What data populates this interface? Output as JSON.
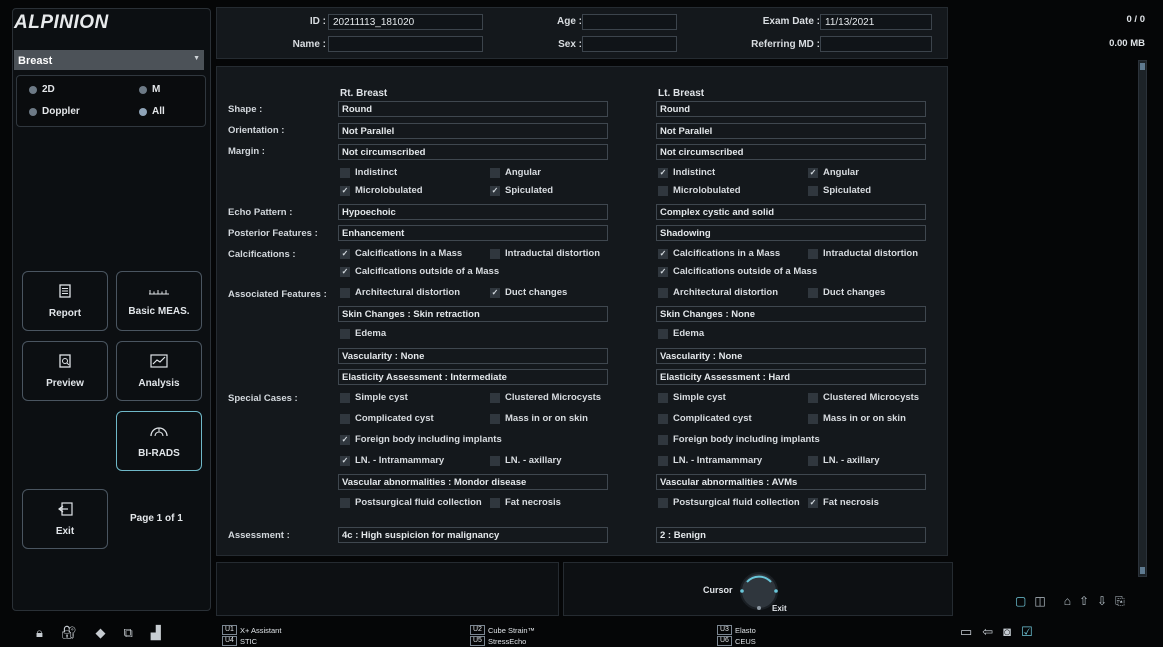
{
  "brand": "ALPINION",
  "preset": "Breast",
  "modes": [
    {
      "label": "2D",
      "selected": false
    },
    {
      "label": "M",
      "selected": false
    },
    {
      "label": "Doppler",
      "selected": false
    },
    {
      "label": "All",
      "selected": true
    }
  ],
  "buttons": {
    "report": "Report",
    "basic_meas": "Basic MEAS.",
    "preview": "Preview",
    "analysis": "Analysis",
    "birads": "BI-RADS",
    "exit": "Exit"
  },
  "page_indicator": "Page 1 of 1",
  "header": {
    "id_label": "ID :",
    "id_value": "20211113_181020",
    "name_label": "Name :",
    "name_value": "",
    "age_label": "Age :",
    "age_value": "",
    "sex_label": "Sex :",
    "sex_value": "",
    "exam_date_label": "Exam Date :",
    "exam_date_value": "11/13/2021",
    "referring_label": "Referring MD :",
    "referring_value": ""
  },
  "columns": {
    "right": "Rt. Breast",
    "left": "Lt. Breast"
  },
  "labels": {
    "shape": "Shape :",
    "orientation": "Orientation :",
    "margin": "Margin :",
    "echo": "Echo Pattern :",
    "posterior": "Posterior Features :",
    "calcifications": "Calcifications :",
    "associated": "Associated Features :",
    "special": "Special Cases :",
    "assessment": "Assessment :"
  },
  "right": {
    "shape": "Round",
    "orientation": "Not Parallel",
    "margin": "Not circumscribed",
    "margin_opts": [
      {
        "label": "Indistinct",
        "checked": false
      },
      {
        "label": "Angular",
        "checked": false
      },
      {
        "label": "Microlobulated",
        "checked": true
      },
      {
        "label": "Spiculated",
        "checked": true
      }
    ],
    "echo": "Hypoechoic",
    "posterior": "Enhancement",
    "calc_opts": [
      {
        "label": "Calcifications in a Mass",
        "checked": true
      },
      {
        "label": "Intraductal distortion",
        "checked": false
      },
      {
        "label": "Calcifications outside of a Mass",
        "checked": true
      }
    ],
    "assoc_opts": [
      {
        "label": "Architectural distortion",
        "checked": false
      },
      {
        "label": "Duct changes",
        "checked": true
      }
    ],
    "skin": "Skin Changes : Skin retraction",
    "edema": {
      "label": "Edema",
      "checked": false
    },
    "vascularity": "Vascularity : None",
    "elasticity": "Elasticity Assessment : Intermediate",
    "special_opts": [
      {
        "label": "Simple cyst",
        "checked": false
      },
      {
        "label": "Clustered Microcysts",
        "checked": false
      },
      {
        "label": "Complicated cyst",
        "checked": false
      },
      {
        "label": "Mass in or on skin",
        "checked": false
      },
      {
        "label": "Foreign body including implants",
        "checked": true
      },
      {
        "label": "LN. - Intramammary",
        "checked": true
      },
      {
        "label": "LN. - axillary",
        "checked": false
      }
    ],
    "vascular_abn": "Vascular abnormalities : Mondor disease",
    "post_opts": [
      {
        "label": "Postsurgical fluid collection",
        "checked": false
      },
      {
        "label": "Fat necrosis",
        "checked": false
      }
    ],
    "assessment": "4c : High suspicion for malignancy"
  },
  "left": {
    "shape": "Round",
    "orientation": "Not Parallel",
    "margin": "Not circumscribed",
    "margin_opts": [
      {
        "label": "Indistinct",
        "checked": true
      },
      {
        "label": "Angular",
        "checked": true
      },
      {
        "label": "Microlobulated",
        "checked": false
      },
      {
        "label": "Spiculated",
        "checked": false
      }
    ],
    "echo": "Complex cystic and solid",
    "posterior": "Shadowing",
    "calc_opts": [
      {
        "label": "Calcifications in a Mass",
        "checked": true
      },
      {
        "label": "Intraductal distortion",
        "checked": false
      },
      {
        "label": "Calcifications outside of a Mass",
        "checked": true
      }
    ],
    "assoc_opts": [
      {
        "label": "Architectural distortion",
        "checked": false
      },
      {
        "label": "Duct changes",
        "checked": false
      }
    ],
    "skin": "Skin Changes : None",
    "edema": {
      "label": "Edema",
      "checked": false
    },
    "vascularity": "Vascularity : None",
    "elasticity": "Elasticity Assessment : Hard",
    "special_opts": [
      {
        "label": "Simple cyst",
        "checked": false
      },
      {
        "label": "Clustered Microcysts",
        "checked": false
      },
      {
        "label": "Complicated cyst",
        "checked": false
      },
      {
        "label": "Mass in or on skin",
        "checked": false
      },
      {
        "label": "Foreign body including implants",
        "checked": false
      },
      {
        "label": "LN. - Intramammary",
        "checked": false
      },
      {
        "label": "LN. - axillary",
        "checked": false
      }
    ],
    "vascular_abn": "Vascular abnormalities : AVMs",
    "post_opts": [
      {
        "label": "Postsurgical fluid collection",
        "checked": false
      },
      {
        "label": "Fat necrosis",
        "checked": true
      }
    ],
    "assessment": "2 : Benign"
  },
  "cursor": {
    "label": "Cursor",
    "exit": "Exit"
  },
  "user_keys": [
    {
      "tag": "U1",
      "label": "X+ Assistant"
    },
    {
      "tag": "U4",
      "label": "STIC"
    },
    {
      "tag": "U2",
      "label": "Cube Strain™"
    },
    {
      "tag": "U5",
      "label": "StressEcho"
    },
    {
      "tag": "U3",
      "label": "Elasto"
    },
    {
      "tag": "U6",
      "label": "CEUS"
    }
  ],
  "counter": "0 / 0",
  "storage": "0.00 MB"
}
